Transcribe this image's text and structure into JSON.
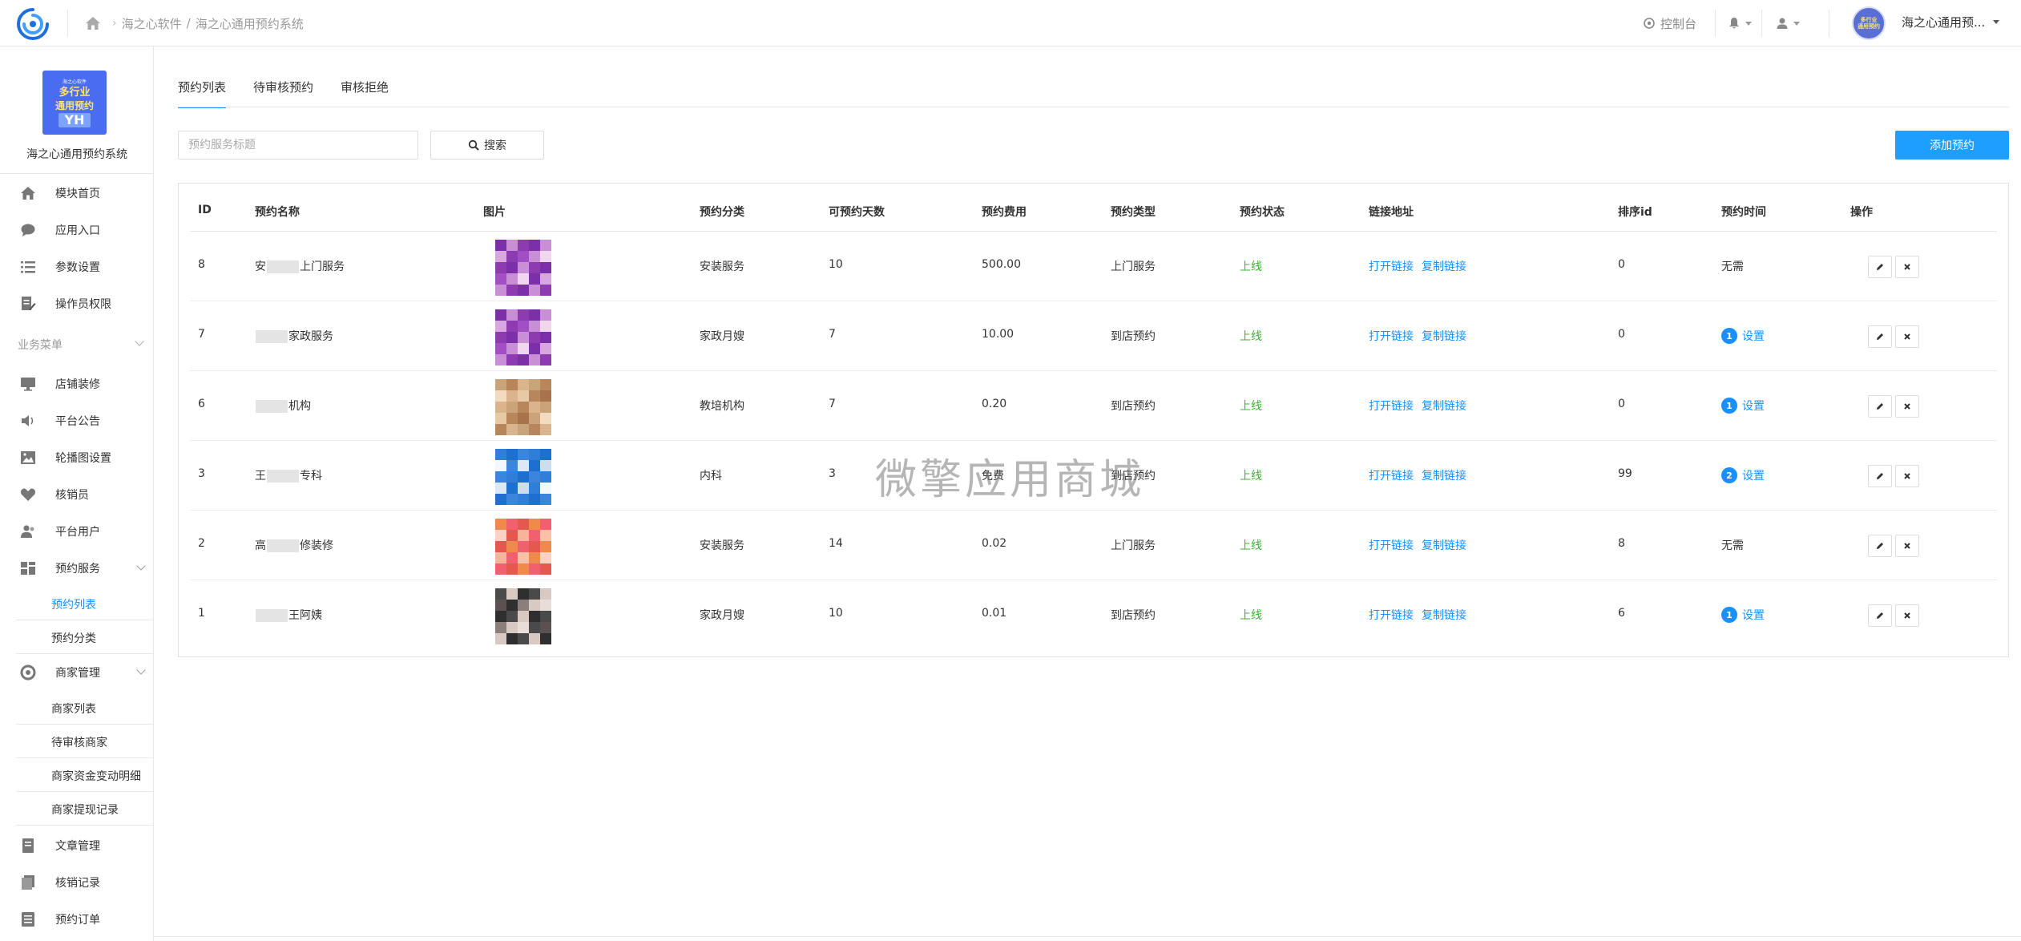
{
  "topbar": {
    "breadcrumb": [
      "海之心软件",
      "海之心通用预约系统"
    ],
    "console_label": "控制台",
    "username": "海之心通用预..."
  },
  "sidebar": {
    "brand_image_lines": [
      "海之心软件",
      "多行业",
      "通用预约",
      "YH"
    ],
    "brand_name": "海之心通用预约系统",
    "items_top": [
      {
        "label": "模块首页",
        "icon": "home-icon"
      },
      {
        "label": "应用入口",
        "icon": "chat-icon"
      },
      {
        "label": "参数设置",
        "icon": "list-icon"
      },
      {
        "label": "操作员权限",
        "icon": "edit-doc-icon"
      }
    ],
    "group_label": "业务菜单",
    "items_business": [
      {
        "label": "店铺装修",
        "icon": "monitor-icon"
      },
      {
        "label": "平台公告",
        "icon": "speaker-icon"
      },
      {
        "label": "轮播图设置",
        "icon": "image-icon"
      },
      {
        "label": "核销员",
        "icon": "heart-icon"
      },
      {
        "label": "平台用户",
        "icon": "users-icon"
      }
    ],
    "service_menu": {
      "label": "预约服务",
      "icon": "grid-icon"
    },
    "service_sub": [
      "预约列表",
      "预约分类"
    ],
    "merchant_menu": {
      "label": "商家管理",
      "icon": "refresh-icon"
    },
    "merchant_sub": [
      "商家列表",
      "待审核商家",
      "商家资金变动明细",
      "商家提现记录"
    ],
    "items_bottom": [
      {
        "label": "文章管理",
        "icon": "book-icon"
      },
      {
        "label": "核销记录",
        "icon": "copy-icon"
      },
      {
        "label": "预约订单",
        "icon": "doc-list-icon"
      }
    ]
  },
  "tabs": [
    "预约列表",
    "待审核预约",
    "审核拒绝"
  ],
  "search": {
    "placeholder": "预约服务标题",
    "button_label": "搜索"
  },
  "add_button_label": "添加预约",
  "table": {
    "headers": [
      "ID",
      "预约名称",
      "图片",
      "预约分类",
      "可预约天数",
      "预约费用",
      "预约类型",
      "预约状态",
      "链接地址",
      "排序id",
      "预约时间",
      "操作"
    ],
    "open_link_label": "打开链接",
    "copy_link_label": "复制链接",
    "set_label": "设置",
    "rows": [
      {
        "id": "8",
        "name_a": "安",
        "name_b": "上门服务",
        "category": "安装服务",
        "days": "10",
        "fee": "500.00",
        "type": "上门服务",
        "status": "上线",
        "sort": "0",
        "time_text": "无需",
        "time_badge": "",
        "thumb": "purple"
      },
      {
        "id": "7",
        "name_a": "",
        "name_b": "家政服务",
        "category": "家政月嫂",
        "days": "7",
        "fee": "10.00",
        "type": "到店预约",
        "status": "上线",
        "sort": "0",
        "time_text": "",
        "time_badge": "1",
        "thumb": "purple"
      },
      {
        "id": "6",
        "name_a": "",
        "name_b": "机构",
        "category": "教培机构",
        "days": "7",
        "fee": "0.20",
        "type": "到店预约",
        "status": "上线",
        "sort": "0",
        "time_text": "",
        "time_badge": "1",
        "thumb": "tan"
      },
      {
        "id": "3",
        "name_a": "王",
        "name_b": "专科",
        "category": "内科",
        "days": "3",
        "fee": "免费",
        "type": "到店预约",
        "status": "上线",
        "sort": "99",
        "time_text": "",
        "time_badge": "2",
        "thumb": "blue"
      },
      {
        "id": "2",
        "name_a": "高",
        "name_b": "修装修",
        "category": "安装服务",
        "days": "14",
        "fee": "0.02",
        "type": "上门服务",
        "status": "上线",
        "sort": "8",
        "time_text": "无需",
        "time_badge": "",
        "thumb": "orange"
      },
      {
        "id": "1",
        "name_a": "",
        "name_b": "王阿姨",
        "category": "家政月嫂",
        "days": "10",
        "fee": "0.01",
        "type": "到店预约",
        "status": "上线",
        "sort": "6",
        "time_text": "",
        "time_badge": "1",
        "thumb": "dark"
      }
    ]
  },
  "watermark": "微擎应用商城",
  "colors": {
    "accent": "#1890ff",
    "primary_button": "#1e9fff",
    "status_online": "#3cb034"
  }
}
